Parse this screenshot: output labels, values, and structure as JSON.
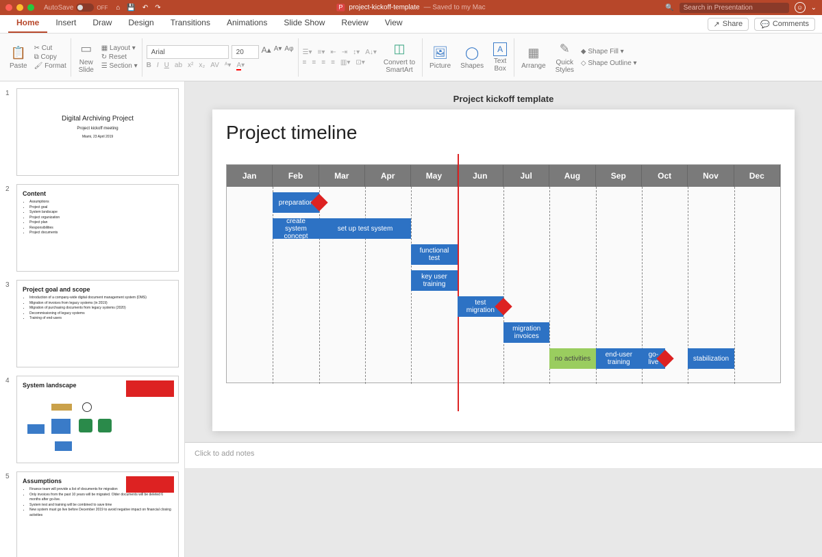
{
  "titlebar": {
    "autosave_label": "AutoSave",
    "autosave_value": "OFF",
    "doc_icon": "P",
    "doc_name": "project-kickoff-template",
    "saved_status": "— Saved to my Mac",
    "search_placeholder": "Search in Presentation"
  },
  "tabs": [
    "Home",
    "Insert",
    "Draw",
    "Design",
    "Transitions",
    "Animations",
    "Slide Show",
    "Review",
    "View"
  ],
  "tab_active": "Home",
  "tab_buttons": {
    "share": "Share",
    "comments": "Comments"
  },
  "ribbon": {
    "paste": "Paste",
    "cut": "Cut",
    "copy": "Copy",
    "format": "Format",
    "new_slide": "New\nSlide",
    "layout": "Layout",
    "reset": "Reset",
    "section": "Section",
    "font_name": "Arial",
    "font_size": "20",
    "convert": "Convert to\nSmartArt",
    "picture": "Picture",
    "shapes": "Shapes",
    "textbox": "Text\nBox",
    "arrange": "Arrange",
    "quickstyles": "Quick\nStyles",
    "shape_fill": "Shape Fill",
    "shape_outline": "Shape Outline"
  },
  "thumbnails": [
    {
      "num": "1",
      "title_c": "Digital Archiving Project",
      "sub1": "Project kickoff meeting",
      "sub2": "Miami, 23 April 2019"
    },
    {
      "num": "2",
      "title": "Content",
      "bullets": [
        "Assumptions",
        "Project goal",
        "System landscape",
        "Project organization",
        "Project plan",
        "Responsibilities",
        "Project documents"
      ]
    },
    {
      "num": "3",
      "title": "Project goal and scope",
      "bullets": [
        "Introduction of a company-wide digital document management system (DMS)",
        "Migration of invoices from legacy systems (in 2019)",
        "Migration of purchasing documents from legacy systems (2020)",
        "Decommissioning of legacy systems",
        "Training of end-users"
      ]
    },
    {
      "num": "4",
      "title": "System landscape"
    },
    {
      "num": "5",
      "title": "Assumptions",
      "bullets": [
        "Finance team will provide a list of documents for migration",
        "Only invoices from the past 10 years will be migrated. Older documents will be deleted 6 months after go-live.",
        "System test and training will be combined to save time",
        "New system must go live before December 2019 to avoid negative impact on financial closing activities"
      ]
    }
  ],
  "slide": {
    "caption": "Project kickoff template",
    "title": "Project timeline",
    "months": [
      "Jan",
      "Feb",
      "Mar",
      "Apr",
      "May",
      "Jun",
      "Jul",
      "Aug",
      "Sep",
      "Oct",
      "Nov",
      "Dec"
    ],
    "today_after_col": 5,
    "bars": [
      {
        "label": "preparation",
        "start": 1,
        "span": 1,
        "row": 0
      },
      {
        "label": "create system concept",
        "start": 1,
        "span": 1,
        "row": 1
      },
      {
        "label": "set up test system",
        "start": 2,
        "span": 2,
        "row": 1
      },
      {
        "label": "functional test",
        "start": 4,
        "span": 1,
        "row": 2
      },
      {
        "label": "key user training",
        "start": 4,
        "span": 1,
        "row": 3
      },
      {
        "label": "test migration",
        "start": 5,
        "span": 1,
        "row": 4
      },
      {
        "label": "migration invoices",
        "start": 6,
        "span": 1,
        "row": 5
      },
      {
        "label": "no activities",
        "start": 7,
        "span": 1,
        "row": 6,
        "color": "green"
      },
      {
        "label": "end-user training",
        "start": 8,
        "span": 1,
        "row": 6
      },
      {
        "label": "go-live",
        "start": 9,
        "span": 0.5,
        "row": 6
      },
      {
        "label": "stabilization",
        "start": 10,
        "span": 1,
        "row": 6
      }
    ],
    "milestones": [
      {
        "at": 2,
        "row": 0
      },
      {
        "at": 6,
        "row": 4
      },
      {
        "at": 9.5,
        "row": 6
      }
    ]
  },
  "notes_placeholder": "Click to add notes"
}
